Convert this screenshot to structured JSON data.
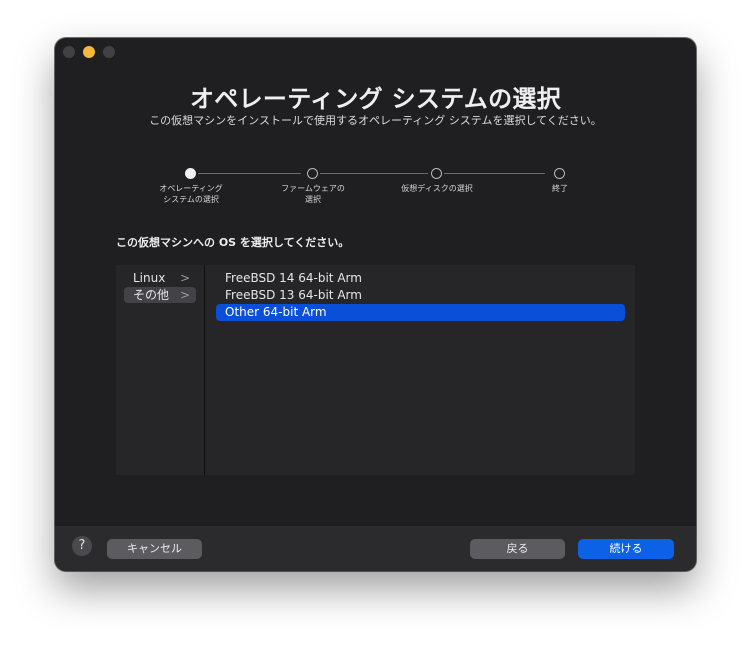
{
  "window": {
    "title": "オペレーティング システムの選択",
    "subtitle": "この仮想マシンをインストールで使用するオペレーティング システムを選択してください。"
  },
  "steps": [
    {
      "line1": "オペレーティング",
      "line2": "システムの選択",
      "active": true
    },
    {
      "line1": "ファームウェアの",
      "line2": "選択",
      "active": false
    },
    {
      "line1": "仮想ディスクの選択",
      "line2": "",
      "active": false
    },
    {
      "line1": "終了",
      "line2": "",
      "active": false
    }
  ],
  "prompt": "この仮想マシンへの OS を選択してください。",
  "os_categories": [
    {
      "label": "Linux",
      "chevron": ">",
      "selected": false
    },
    {
      "label": "その他",
      "chevron": ">",
      "selected": true
    }
  ],
  "os_list": [
    {
      "label": "FreeBSD 14 64-bit Arm",
      "selected": false
    },
    {
      "label": "FreeBSD 13 64-bit Arm",
      "selected": false
    },
    {
      "label": "Other 64-bit Arm",
      "selected": true
    }
  ],
  "footer": {
    "help": "?",
    "cancel": "キャンセル",
    "back": "戻る",
    "continue": "続ける"
  },
  "colors": {
    "accent": "#0a4fd8",
    "window_bg": "#1f1f21",
    "minimize": "#f6b73e"
  }
}
